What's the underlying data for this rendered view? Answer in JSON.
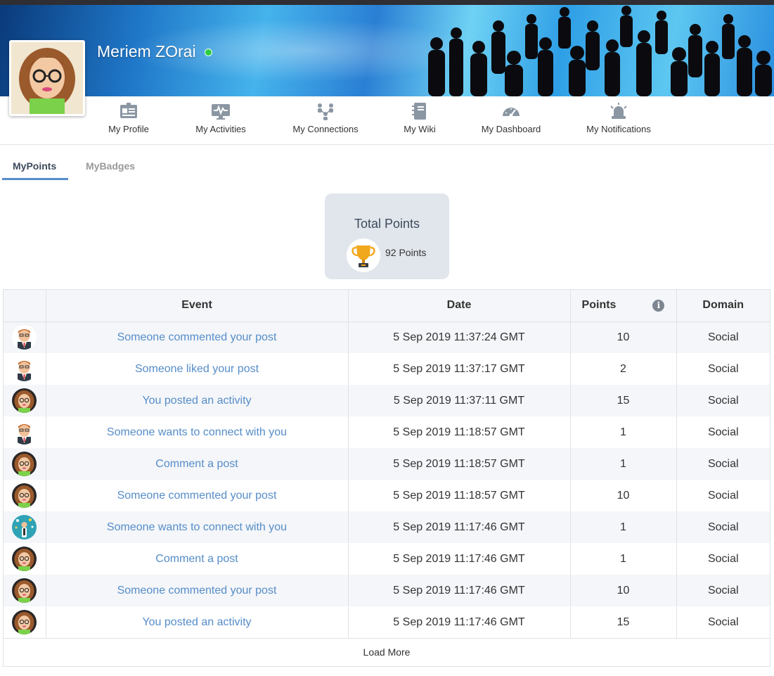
{
  "user": {
    "name": "Meriem ZOrai",
    "status_color": "#2ecc40"
  },
  "nav": [
    {
      "key": "profile",
      "label": "My Profile",
      "icon": "profile-card-icon"
    },
    {
      "key": "activities",
      "label": "My Activities",
      "icon": "activity-monitor-icon"
    },
    {
      "key": "connections",
      "label": "My Connections",
      "icon": "connections-icon"
    },
    {
      "key": "wiki",
      "label": "My Wiki",
      "icon": "notebook-icon"
    },
    {
      "key": "dashboard",
      "label": "My Dashboard",
      "icon": "gauge-icon"
    },
    {
      "key": "notifications",
      "label": "My Notifications",
      "icon": "alarm-bell-icon"
    }
  ],
  "tabs": {
    "points": "MyPoints",
    "badges": "MyBadges",
    "active": "MyPoints"
  },
  "summary": {
    "title": "Total Points",
    "value": "92 Points",
    "icon": "trophy-icon"
  },
  "table": {
    "headers": {
      "event": "Event",
      "date": "Date",
      "points": "Points",
      "domain": "Domain"
    },
    "rows": [
      {
        "avatar": "man",
        "event": "Someone commented your post",
        "date": "5 Sep 2019 11:37:24 GMT",
        "points": "10",
        "domain": "Social"
      },
      {
        "avatar": "man",
        "event": "Someone liked your post",
        "date": "5 Sep 2019 11:37:17 GMT",
        "points": "2",
        "domain": "Social"
      },
      {
        "avatar": "woman",
        "event": "You posted an activity",
        "date": "5 Sep 2019 11:37:11 GMT",
        "points": "15",
        "domain": "Social"
      },
      {
        "avatar": "man",
        "event": "Someone wants to connect with you",
        "date": "5 Sep 2019 11:18:57 GMT",
        "points": "1",
        "domain": "Social"
      },
      {
        "avatar": "woman",
        "event": "Comment a post",
        "date": "5 Sep 2019 11:18:57 GMT",
        "points": "1",
        "domain": "Social"
      },
      {
        "avatar": "woman",
        "event": "Someone commented your post",
        "date": "5 Sep 2019 11:18:57 GMT",
        "points": "10",
        "domain": "Social"
      },
      {
        "avatar": "teal",
        "event": "Someone wants to connect with you",
        "date": "5 Sep 2019 11:17:46 GMT",
        "points": "1",
        "domain": "Social"
      },
      {
        "avatar": "woman",
        "event": "Comment a post",
        "date": "5 Sep 2019 11:17:46 GMT",
        "points": "1",
        "domain": "Social"
      },
      {
        "avatar": "woman",
        "event": "Someone commented your post",
        "date": "5 Sep 2019 11:17:46 GMT",
        "points": "10",
        "domain": "Social"
      },
      {
        "avatar": "woman",
        "event": "You posted an activity",
        "date": "5 Sep 2019 11:17:46 GMT",
        "points": "15",
        "domain": "Social"
      }
    ],
    "load_more": "Load More"
  },
  "colors": {
    "link": "#568dc9",
    "card": "#e1e6ec",
    "tab_active": "#568dc9"
  }
}
